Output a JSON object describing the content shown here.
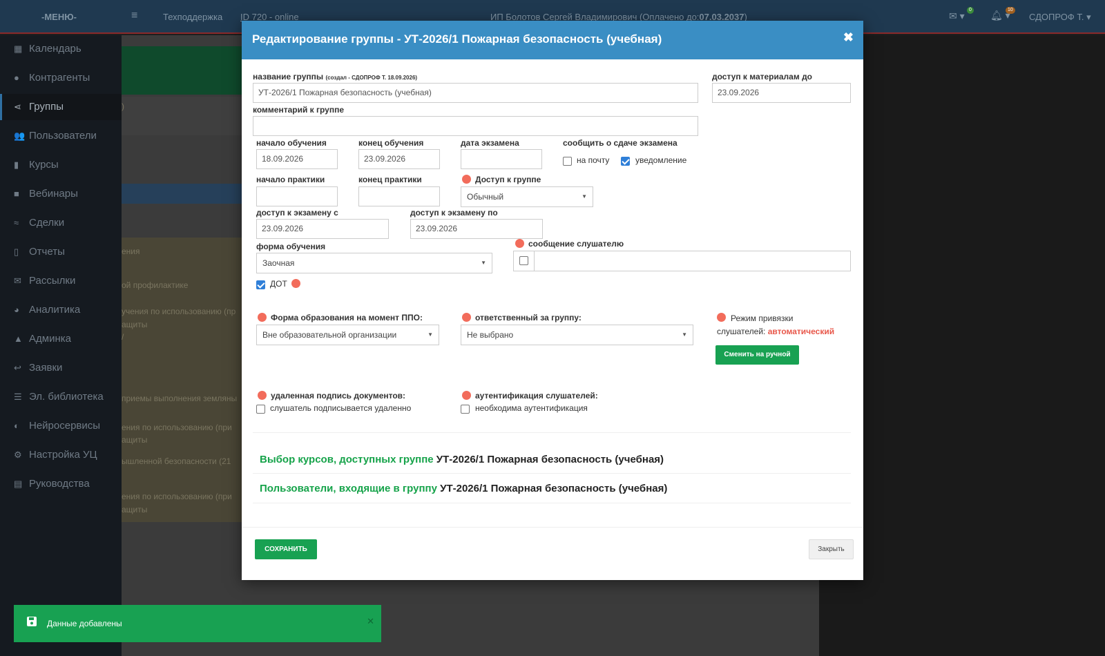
{
  "topbar": {
    "menu": "-МЕНЮ-",
    "support": "Техподдержка",
    "id_status": "ID 720 - online",
    "company_prefix": "ИП Болотов Сергей Владимирович (Оплачено до:",
    "company_date": "07.03.2037",
    "company_suffix": ")",
    "mail_badge": "0",
    "bell_badge": "10",
    "user": "СДОПРОФ Т."
  },
  "sidebar": {
    "items": [
      {
        "icon": "calendar-icon",
        "glyph": "▦",
        "label": "Календарь"
      },
      {
        "icon": "contractors-icon",
        "glyph": "●",
        "label": "Контрагенты"
      },
      {
        "icon": "share-icon",
        "glyph": "⋖",
        "label": "Группы",
        "active": true
      },
      {
        "icon": "users-icon",
        "glyph": "👥",
        "label": "Пользователи"
      },
      {
        "icon": "book-icon",
        "glyph": "▮",
        "label": "Курсы"
      },
      {
        "icon": "video-icon",
        "glyph": "■",
        "label": "Вебинары"
      },
      {
        "icon": "handshake-icon",
        "glyph": "≈",
        "label": "Сделки"
      },
      {
        "icon": "report-icon",
        "glyph": "▯",
        "label": "Отчеты"
      },
      {
        "icon": "envelope-icon",
        "glyph": "✉",
        "label": "Рассылки"
      },
      {
        "icon": "pie-chart-icon",
        "glyph": "◕",
        "label": "Аналитика"
      },
      {
        "icon": "lock-icon",
        "glyph": "▲",
        "label": "Админка"
      },
      {
        "icon": "reply-icon",
        "glyph": "↩",
        "label": "Заявки"
      },
      {
        "icon": "list-icon",
        "glyph": "☰",
        "label": "Эл. библиотека"
      },
      {
        "icon": "brain-icon",
        "glyph": "◐",
        "label": "Нейросервисы"
      },
      {
        "icon": "gears-icon",
        "glyph": "⚙",
        "label": "Настройка УЦ"
      },
      {
        "icon": "guide-icon",
        "glyph": "▤",
        "label": "Руководства"
      }
    ]
  },
  "background": {
    "row1": ")",
    "row2": "ения",
    "row3": "ой профилактике",
    "row4a": "учения по использованию (пр",
    "row4b": "ащиты",
    "row4c": "/",
    "row5": "приемы выполнения земляны",
    "row6a": "ения по использованию (при",
    "row6b": "ащиты",
    "row7": "ышленной безопасности (21",
    "row8a": "ения по использованию (при",
    "row8b": "ащиты"
  },
  "modal": {
    "title": "Редактирование группы - УТ-2026/1 Пожарная безопасность (учебная)",
    "close": "✖",
    "group_name_label": "название группы",
    "group_name_meta": "(создал - СДОПРОФ Т. 18.09.2026)",
    "group_name_value": "УТ-2026/1 Пожарная безопасность (учебная)",
    "access_until_label": "доступ к материалам до",
    "access_until_value": "23.09.2026",
    "comment_label": "комментарий к группе",
    "comment_value": "",
    "train_start_label": "начало обучения",
    "train_start_value": "18.09.2026",
    "train_end_label": "конец обучения",
    "train_end_value": "23.09.2026",
    "exam_date_label": "дата экзамена",
    "exam_date_value": "",
    "notify_label": "сообщить о сдаче экзамена",
    "notify_mail_label": "на почту",
    "notify_mail_checked": false,
    "notify_push_label": "уведомление",
    "notify_push_checked": true,
    "practice_start_label": "начало практики",
    "practice_start_value": "",
    "practice_end_label": "конец практики",
    "practice_end_value": "",
    "group_access_label": "Доступ к группе",
    "group_access_value": "Обычный",
    "exam_from_label": "доступ к экзамену с",
    "exam_from_value": "23.09.2026",
    "exam_to_label": "доступ к экзамену по",
    "exam_to_value": "23.09.2026",
    "form_label": "форма обучения",
    "form_value": "Заочная",
    "listener_msg_label": "сообщение слушателю",
    "listener_msg_checked": false,
    "listener_msg_value": "",
    "dot_label": "ДОТ",
    "dot_checked": true,
    "edu_form_label": "Форма образования на момент ППО:",
    "edu_form_value": "Вне образовательной организации",
    "responsible_label": "ответственный за группу:",
    "responsible_value": "Не выбрано",
    "binding_label_1": "Режим привязки",
    "binding_label_2": "слушателей:",
    "binding_mode": "автоматический",
    "binding_button": "Сменить на ручной",
    "remote_sign_label": "удаленная подпись документов:",
    "remote_sign_cb_label": "слушатель подписывается удаленно",
    "remote_sign_checked": false,
    "auth_label": "аутентификация слушателей:",
    "auth_cb_label": "необходима аутентификация",
    "auth_checked": false,
    "courses_link": "Выбор курсов, доступных группе",
    "courses_group": "УТ-2026/1 Пожарная безопасность (учебная)",
    "users_link": "Пользователи, входящие в группу",
    "users_group": "УТ-2026/1 Пожарная безопасность (учебная)",
    "save_button": "СОХРАНИТЬ",
    "close_button": "Закрыть"
  },
  "toast": {
    "text": "Данные добавлены",
    "close": "✕"
  },
  "colors": {
    "modal_header": "#3a8ec4",
    "green_button": "#18a152",
    "link_green": "#16a34a",
    "info_dot": "#f26c5b",
    "binding_mode": "#e8574a"
  }
}
